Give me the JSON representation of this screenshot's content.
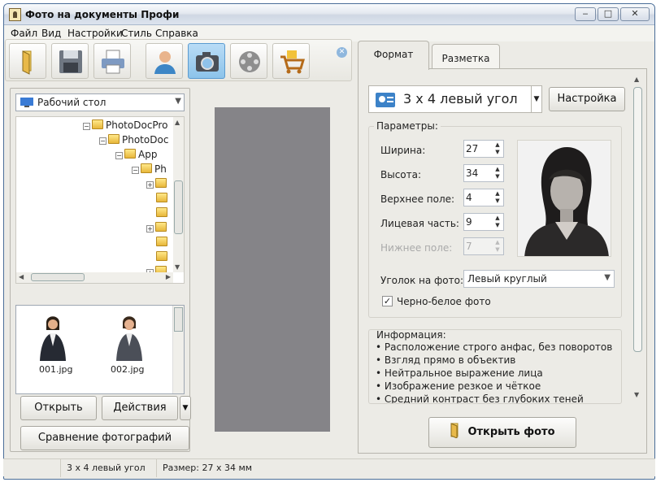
{
  "window": {
    "title": "Фото на документы Профи"
  },
  "menu": [
    "Файл",
    "Вид",
    "Настройки",
    "Стиль",
    "Справка"
  ],
  "toolbar": {
    "tools": [
      "open-icon",
      "save-icon",
      "print-icon",
      "user-icon",
      "camera-icon",
      "film-icon",
      "cart-icon"
    ],
    "active_tool": "camera-icon"
  },
  "browser": {
    "location": "Рабочий стол",
    "tree": [
      "PhotoDocPro",
      "PhotoDoc",
      "App",
      "Ph"
    ],
    "thumbnails": [
      "001.jpg",
      "002.jpg"
    ],
    "open_label": "Открыть",
    "actions_label": "Действия",
    "compare_label": "Сравнение фотографий"
  },
  "tabs": [
    "Формат",
    "Разметка"
  ],
  "format": {
    "selected": "3 x 4 левый угол",
    "settings_label": "Настройка",
    "params_title": "Параметры:",
    "width_label": "Ширина:",
    "width": "27",
    "height_label": "Высота:",
    "height": "34",
    "top_margin_label": "Верхнее поле:",
    "top_margin": "4",
    "face_label": "Лицевая часть:",
    "face": "9",
    "bottom_margin_label": "Нижнее поле:",
    "bottom_margin": "7",
    "corner_label": "Уголок на фото:",
    "corner_value": "Левый круглый",
    "bw_label": "Черно-белое фото",
    "info_title": "Информация:",
    "info": [
      "Расположение строго анфас, без поворотов",
      "Взгляд прямо в объектив",
      "Нейтральное выражение лица",
      "Изображение резкое и чёткое",
      "Средний контраст без глубоких теней"
    ],
    "open_photo_label": "Открыть фото"
  },
  "status": {
    "format": "3 x 4 левый угол",
    "size": "Размер: 27 x 34 мм"
  },
  "colors": {
    "preview": "#858488",
    "titlebar": "#dde4ee",
    "window": "#ecebe6"
  }
}
